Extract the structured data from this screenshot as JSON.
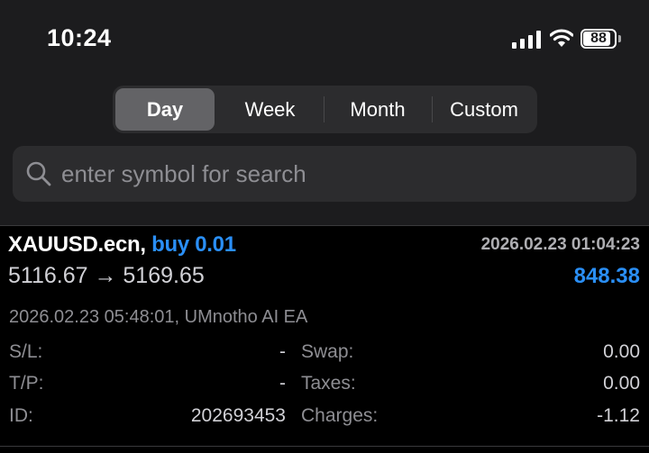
{
  "status_bar": {
    "time": "10:24",
    "battery": "88",
    "battery_level_percent": 88,
    "icons": [
      "signal-icon",
      "wifi-icon",
      "battery-icon"
    ]
  },
  "period_selector": {
    "tabs": [
      {
        "label": "Day",
        "selected": true
      },
      {
        "label": "Week",
        "selected": false
      },
      {
        "label": "Month",
        "selected": false
      },
      {
        "label": "Custom",
        "selected": false
      }
    ]
  },
  "search": {
    "placeholder": "enter symbol for search",
    "value": "",
    "icon": "search-icon"
  },
  "trades": [
    {
      "symbol": "XAUUSD.ecn,",
      "direction": "buy 0.01",
      "open_time": "2026.02.23 01:04:23",
      "prices": "5116.67 → 5169.65",
      "profit": "848.38",
      "comment": "2026.02.23 05:48:01, UMnotho AI EA",
      "sl_label": "S/L:",
      "sl_value": "-",
      "tp_label": "T/P:",
      "tp_value": "-",
      "id_label": "ID:",
      "id_value": "202693453",
      "swap_label": "Swap:",
      "swap_value": "0.00",
      "taxes_label": "Taxes:",
      "taxes_value": "0.00",
      "charges_label": "Charges:",
      "charges_value": "-1.12"
    }
  ],
  "colors": {
    "background": "#1c1c1e",
    "list_background": "#000000",
    "accent_blue": "#2a8ff7",
    "secondary_text": "#8e8e93",
    "control_background": "#2c2c2e",
    "selected_segment": "#636366"
  }
}
